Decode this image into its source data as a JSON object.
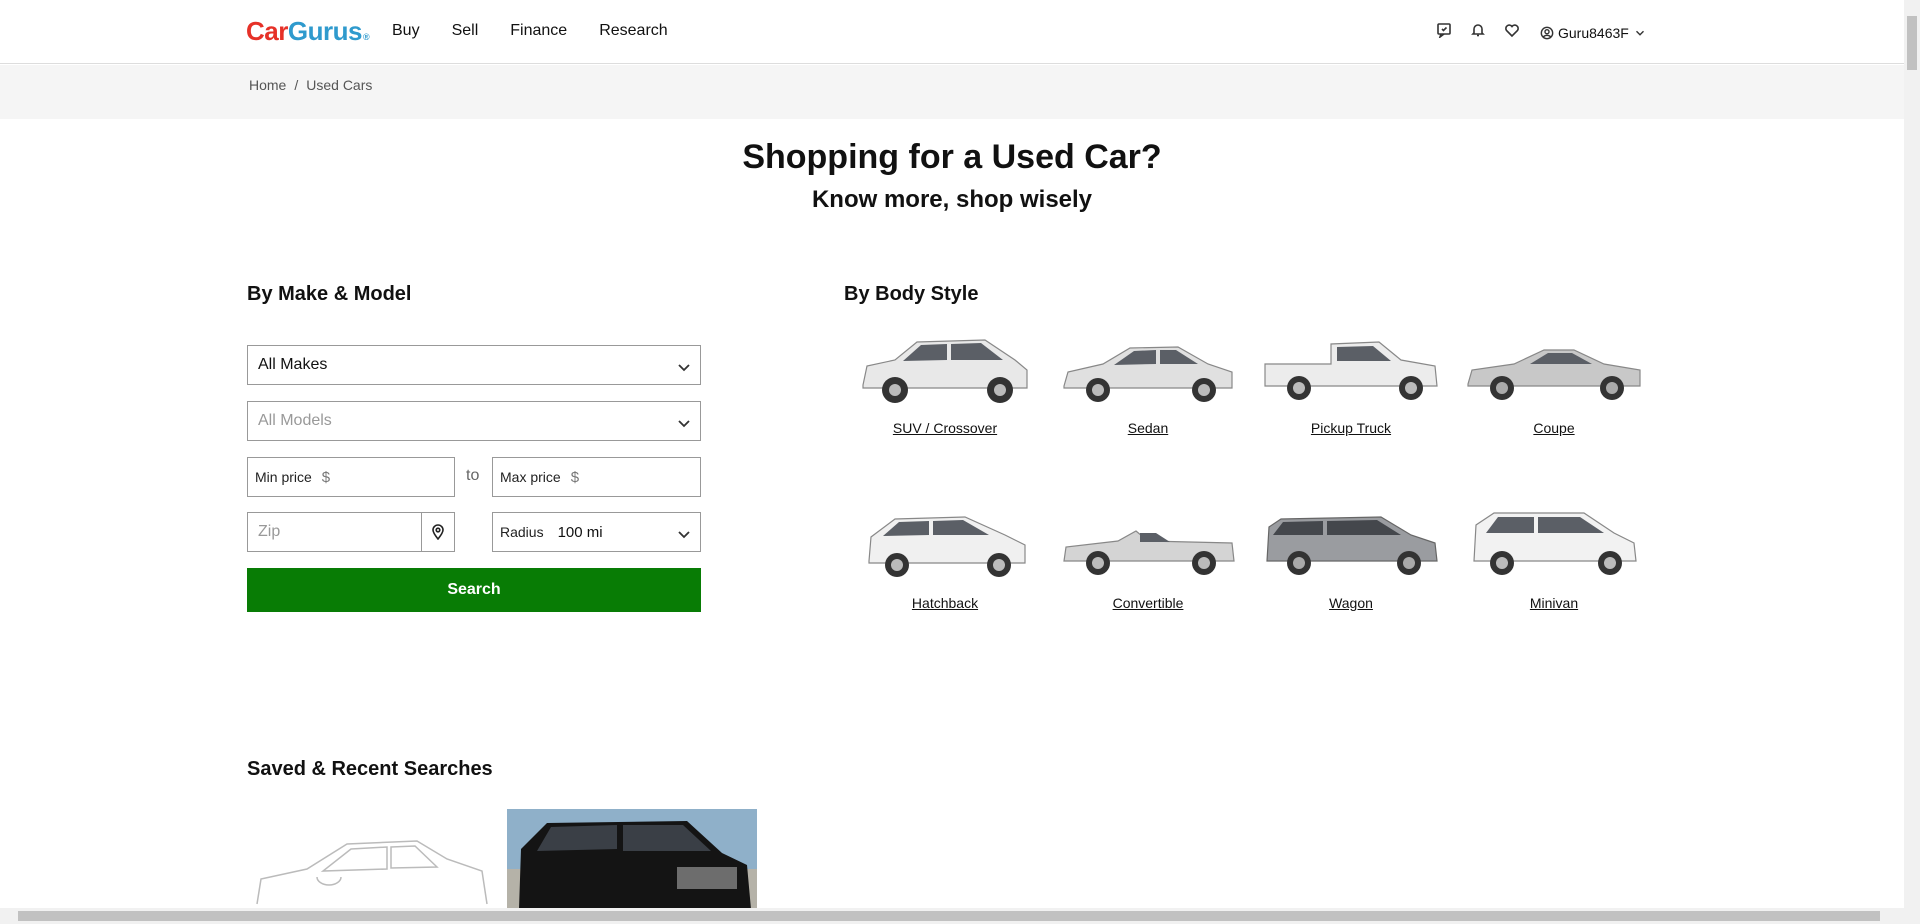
{
  "header": {
    "logo_car": "Car",
    "logo_gurus": "Gurus",
    "logo_mark": "®",
    "nav": [
      "Buy",
      "Sell",
      "Finance",
      "Research"
    ],
    "username": "Guru8463F"
  },
  "breadcrumb": {
    "items": [
      "Home",
      "/",
      "Used Cars"
    ]
  },
  "hero": {
    "title": "Shopping for a Used Car?",
    "subtitle": "Know more, shop wisely"
  },
  "make_model": {
    "heading": "By Make & Model",
    "makes_value": "All Makes",
    "models_placeholder": "All Models",
    "min_price_label": "Min price",
    "max_price_label": "Max price",
    "currency": "$",
    "to": "to",
    "zip_placeholder": "Zip",
    "radius_label": "Radius",
    "radius_value": "100 mi",
    "search_label": "Search"
  },
  "body_style": {
    "heading": "By Body Style",
    "items": [
      "SUV / Crossover",
      "Sedan",
      "Pickup Truck",
      "Coupe",
      "Hatchback",
      "Convertible",
      "Wagon",
      "Minivan"
    ]
  },
  "saved": {
    "heading": "Saved & Recent Searches"
  },
  "colors": {
    "brand_red": "#e63128",
    "brand_blue": "#2f9acd",
    "search_green": "#087c05"
  }
}
